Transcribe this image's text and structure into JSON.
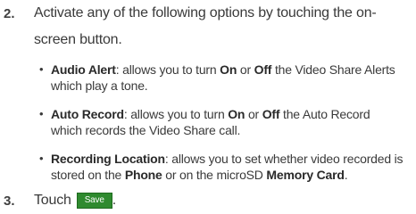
{
  "steps": [
    {
      "number": "2.",
      "line1": "Activate any of the following options by touching the on-",
      "line2": "screen button."
    },
    {
      "number": "3.",
      "text": "Touch",
      "button": "Save",
      "tail": "."
    }
  ],
  "options": [
    {
      "term": "Audio Alert",
      "p1": ": allows you to turn ",
      "b1": "On",
      "p2": " or ",
      "b2": "Off",
      "p3": " the Video Share Alerts which play a tone."
    },
    {
      "term": "Auto Record",
      "p1": ": allows you to turn ",
      "b1": "On",
      "p2": " or ",
      "b2": "Off",
      "p3": " the Auto Record which records the Video Share call."
    },
    {
      "term": "Recording Location",
      "p1": ": allows you to set whether video recorded is stored on the ",
      "b1": "Phone",
      "p2": " or on the microSD ",
      "b2": "Memory Card",
      "p3": "."
    }
  ]
}
